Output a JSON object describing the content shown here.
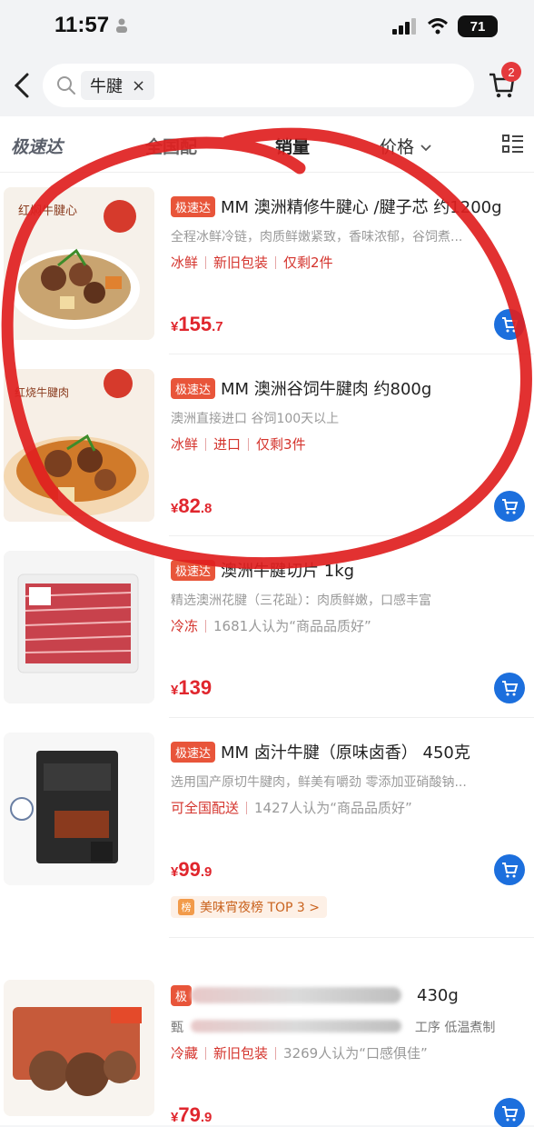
{
  "status": {
    "time": "11:57",
    "battery": "71"
  },
  "search": {
    "query_tag": "牛腱",
    "close": "×",
    "cart_count": "2"
  },
  "sort": {
    "fast": "极速达",
    "national": "全国配",
    "sales": "销量",
    "price": "价格"
  },
  "products": [
    {
      "badge": "极速达",
      "title": "MM 澳洲精修牛腱心 /腱子芯  约1200g",
      "desc": "全程冰鲜冷链，肉质鲜嫩紧致，香味浓郁，谷饲煮...",
      "tag1": "冰鲜",
      "tag2": "新旧包装",
      "tag3": "仅剩2件",
      "price_int": "155",
      "price_dec": ".7",
      "thumb_text": "红焖牛腱心"
    },
    {
      "badge": "极速达",
      "title": "MM 澳洲谷饲牛腱肉  约800g",
      "desc": "澳洲直接进口 谷饲100天以上",
      "tag1": "冰鲜",
      "tag2": "进口",
      "tag3": "仅剩3件",
      "price_int": "82",
      "price_dec": ".8",
      "thumb_text": "红烧牛腱肉"
    },
    {
      "badge": "极速达",
      "title": "澳洲牛腱切片 1kg",
      "desc": "精选澳洲花腱（三花趾）：肉质鲜嫩，口感丰富",
      "tag1": "冷冻",
      "tag2": "1681人认为“商品品质好”",
      "price_int": "139",
      "price_dec": ""
    },
    {
      "badge": "极速达",
      "title": "MM 卤汁牛腱（原味卤香） 450克",
      "desc": "选用国产原切牛腱肉，鲜美有嚼劲 零添加亚硝酸钠...",
      "tag1": "可全国配送",
      "tag2": "1427人认为“商品品质好”",
      "price_int": "99",
      "price_dec": ".9",
      "rank": "美味宵夜榜 TOP 3 >",
      "rank_icon": "榜"
    },
    {
      "badge": "极",
      "title": "430g",
      "desc_left": "甄",
      "desc_right": "工序 低温煮制",
      "tag1": "冷藏",
      "tag2": "新旧包装",
      "tag3": "3269人认为“口感俱佳”",
      "price_int": "79",
      "price_dec": ".9"
    }
  ],
  "colors": {
    "accent": "#e0262d",
    "blue": "#1c6fdd",
    "circle": "#e02020"
  }
}
